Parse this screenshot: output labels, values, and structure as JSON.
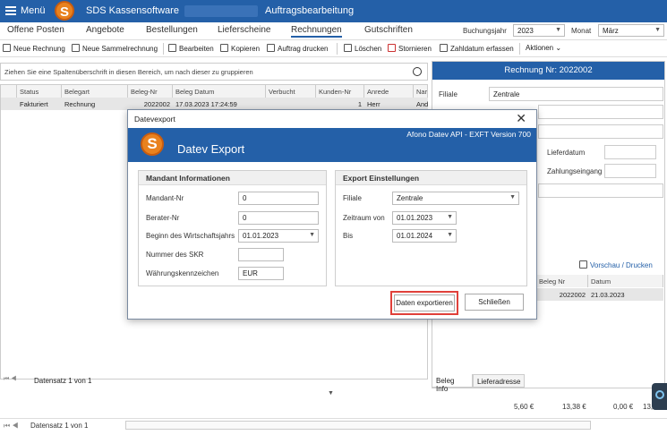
{
  "titlebar": {
    "menu": "Menü",
    "app_title": "SDS Kassensoftware",
    "section": "Auftragsbearbeitung"
  },
  "navtabs": [
    "Offene Posten",
    "Angebote",
    "Bestellungen",
    "Lieferscheine",
    "Rechnungen",
    "Gutschriften"
  ],
  "filters": {
    "year_label": "Buchungsjahr",
    "year_value": "2023",
    "month_label": "Monat",
    "month_value": "März"
  },
  "toolbar": {
    "new_invoice": "Neue Rechnung",
    "new_collective": "Neue Sammelrechnung",
    "edit": "Bearbeiten",
    "copy": "Kopieren",
    "print": "Auftrag drucken",
    "delete": "Löschen",
    "cancel": "Stornieren",
    "payment_date": "Zahldatum erfassen",
    "actions": "Aktionen"
  },
  "groupbar": {
    "hint": "Ziehen Sie eine Spaltenüberschrift in diesen Bereich, um nach dieser zu gruppieren"
  },
  "grid": {
    "headers": [
      "Status",
      "Belegart",
      "Beleg-Nr",
      "Beleg Datum",
      "Verbucht",
      "Kunden-Nr",
      "Anrede",
      "Nar"
    ],
    "row": [
      "Fakturiert",
      "Rechnung",
      "2022002",
      "17.03.2023 17:24:59",
      "",
      "1",
      "Herr",
      "And"
    ]
  },
  "pager": {
    "records": "Datensatz 1 von 1"
  },
  "right_panel": {
    "header": "Rechnung Nr: 2022002",
    "filiale_label": "Filiale",
    "filiale_value": "Zentrale",
    "lieferdatum_label": "Lieferdatum",
    "zahlungseingang_label": "Zahlungseingang",
    "preview_print": "Vorschau / Drucken",
    "mini_headers": [
      "Beleg Nr",
      "Datum"
    ],
    "mini_row": [
      "2022002",
      "21.03.2023"
    ],
    "tabs": [
      "Beleg Info",
      "Lieferadresse"
    ]
  },
  "totals": [
    "5,60 €",
    "13,38 €",
    "0,00 €",
    "13,38 €"
  ],
  "dialog": {
    "title": "Datevexport",
    "close": "✕",
    "banner_title": "Datev Export",
    "version": "Afono Datev API - EXFT Version 700",
    "mandant": {
      "title": "Mandant Informationen",
      "mandant_nr_label": "Mandant-Nr",
      "mandant_nr": "0",
      "berater_nr_label": "Berater-Nr",
      "berater_nr": "0",
      "fy_start_label": "Beginn des Wirtschaftsjahrs",
      "fy_start": "01.01.2023",
      "skr_label": "Nummer des SKR",
      "skr": "",
      "currency_label": "Währungskennzeichen",
      "currency": "EUR"
    },
    "export": {
      "title": "Export Einstellungen",
      "filiale_label": "Filiale",
      "filiale": "Zentrale",
      "from_label": "Zeitraum von",
      "from": "01.01.2023",
      "to_label": "Bis",
      "to": "01.01.2024"
    },
    "export_button": "Daten exportieren",
    "close_button": "Schließen"
  }
}
